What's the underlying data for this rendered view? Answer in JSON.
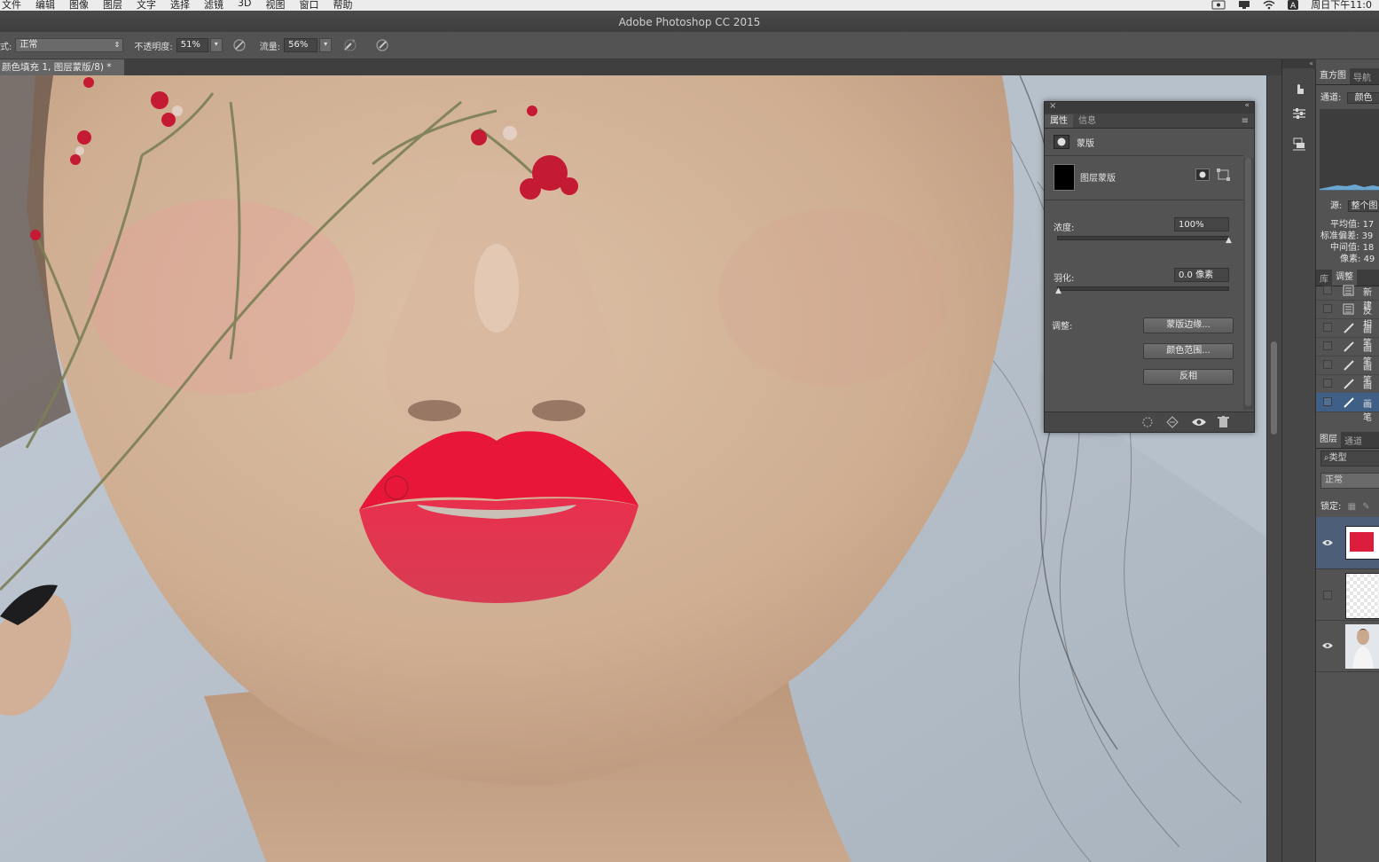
{
  "menubar": {
    "items": [
      "文件",
      "编辑",
      "图像",
      "图层",
      "文字",
      "选择",
      "滤镜",
      "3D",
      "视图",
      "窗口",
      "帮助"
    ],
    "clock": "周日下午11:0"
  },
  "window": {
    "title": "Adobe Photoshop CC 2015"
  },
  "options_bar": {
    "mode_label": "式:",
    "mode_value": "正常",
    "opacity_label": "不透明度:",
    "opacity_value": "51%",
    "flow_label": "流量:",
    "flow_value": "56%"
  },
  "document": {
    "tab_title": "颜色填充 1, 图层蒙版/8) *"
  },
  "properties_panel": {
    "tabs": [
      "属性",
      "信息"
    ],
    "section_label": "蒙版",
    "mask_name": "图层蒙版",
    "density_label": "浓度:",
    "density_value": "100%",
    "density_level": 1.0,
    "feather_label": "羽化:",
    "feather_value": "0.0 像素",
    "feather_level": 0.0,
    "adjust_label": "调整:",
    "buttons": [
      "蒙版边缘...",
      "颜色范围...",
      "反相"
    ]
  },
  "histogram_panel": {
    "tabs": [
      "直方图",
      "导航"
    ],
    "channel_label": "通道:",
    "channel_value": "颜色",
    "source_label": "源:",
    "source_value": "整个图",
    "stats": [
      {
        "label": "平均值:",
        "value": "17"
      },
      {
        "label": "标准偏差:",
        "value": "39"
      },
      {
        "label": "中间值:",
        "value": "18"
      },
      {
        "label": "像素:",
        "value": "49"
      }
    ]
  },
  "history_panel": {
    "tabs": [
      "库",
      "调整"
    ],
    "items": [
      "新建",
      "反相",
      "画笔",
      "画笔",
      "画笔",
      "画笔",
      "画笔"
    ]
  },
  "layers_panel": {
    "tabs": [
      "图层",
      "通道"
    ],
    "filter_label": "类型",
    "blend_value": "正常",
    "lock_label": "锁定:",
    "accent_color": "#dc1e3c"
  }
}
